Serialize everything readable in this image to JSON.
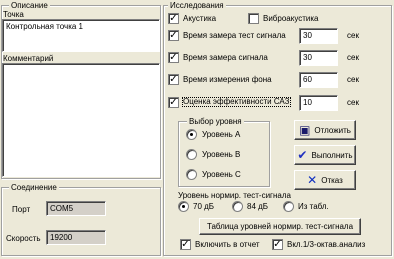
{
  "left": {
    "description_legend": "Описание",
    "point_label": "Точка",
    "point_value": "Контрольная точка 1",
    "comment_label": "Комментарий",
    "comment_value": "",
    "connection_legend": "Соединение",
    "port_label": "Порт",
    "port_value": "COM5",
    "speed_label": "Скорость",
    "speed_value": "19200"
  },
  "research": {
    "legend": "Исследования",
    "acoustics": {
      "label": "Акустика",
      "checked": true
    },
    "vibro": {
      "label": "Виброакустика",
      "checked": false
    },
    "rows": [
      {
        "label": "Время замера тест сигнала",
        "value": "30",
        "unit": "сек",
        "checked": true
      },
      {
        "label": "Время  замера сигнала",
        "value": "30",
        "unit": "сек",
        "checked": true
      },
      {
        "label": "Время измерения фона",
        "value": "60",
        "unit": "сек",
        "checked": true
      },
      {
        "label": "Оценка эффективности САЗ",
        "value": "10",
        "unit": "сек",
        "checked": true
      }
    ],
    "level_select": {
      "legend": "Выбор уровня",
      "options": [
        "Уровень А",
        "Уровень В",
        "Уровень С"
      ],
      "selected_index": 0
    },
    "buttons": {
      "defer": "Отложить",
      "execute": "Выполнить",
      "cancel": "Отказ"
    },
    "norm_level": {
      "label": "Уровень нормир. тест-сигнала",
      "options": [
        "70 дБ",
        "84 дБ",
        "Из табл."
      ],
      "selected_index": 0
    },
    "table_button": "Таблица уровней нормир. тест-сигнала",
    "include_report": {
      "label": "Включить в отчет",
      "checked": true
    },
    "octave_analysis": {
      "label": "Вкл.1/3-октав.анализ",
      "checked": true
    }
  }
}
